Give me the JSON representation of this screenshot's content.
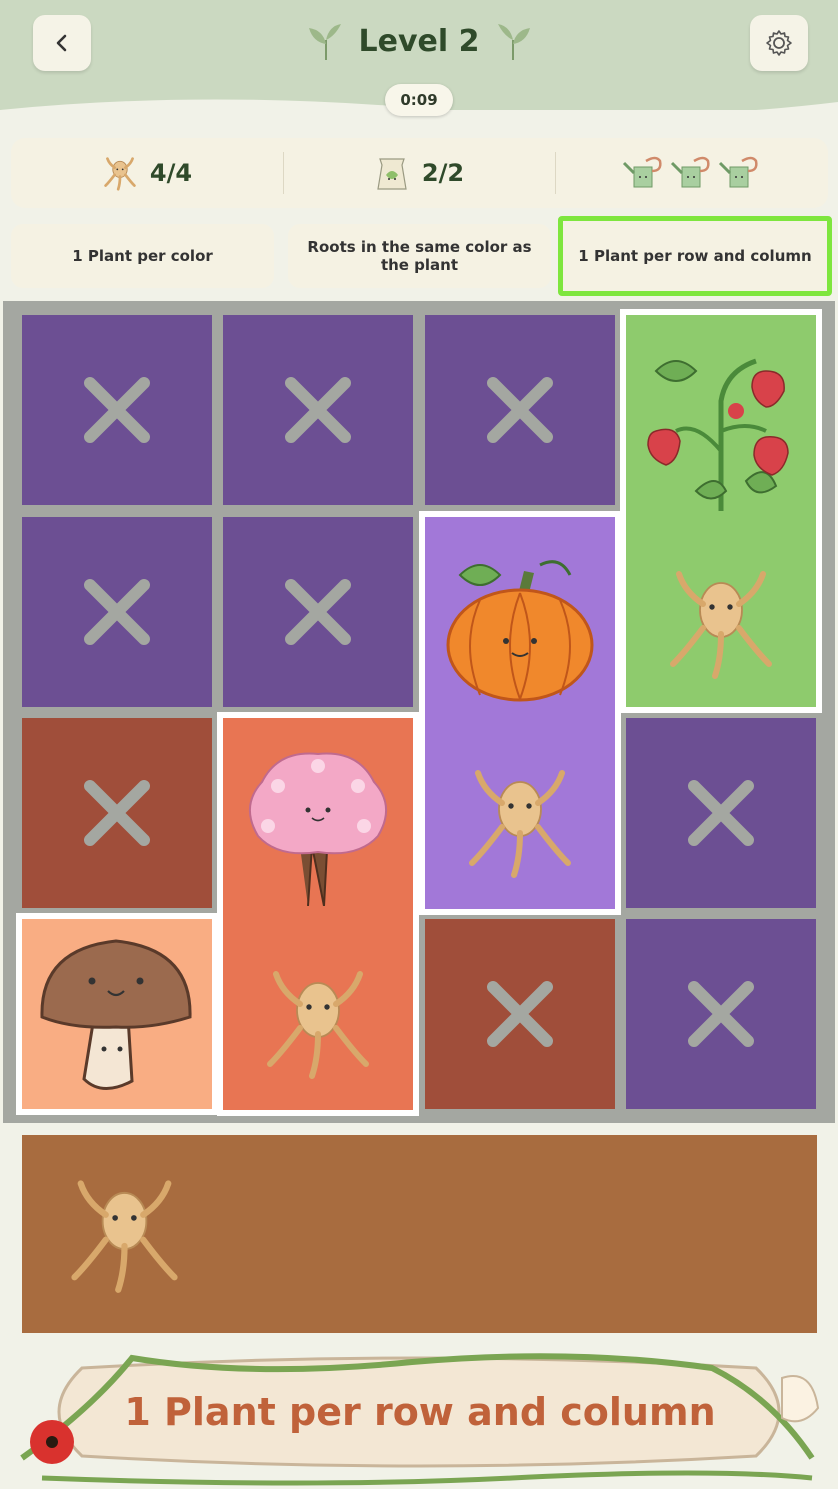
{
  "header": {
    "title": "Level 2",
    "timer": "0:09"
  },
  "stats": {
    "roots": "4/4",
    "seeds": "2/2",
    "watering_cans_count": 3
  },
  "rules": [
    {
      "label": "1 Plant per color",
      "active": false
    },
    {
      "label": "Roots in the same color as the plant",
      "active": false
    },
    {
      "label": "1 Plant per row and column",
      "active": true
    }
  ],
  "board": {
    "colors": {
      "purple": "#6c4f93",
      "light_purple": "#a278d8",
      "green": "#8ecb6d",
      "brown": "#a04e3a",
      "orange": "#e87553",
      "peach": "#f9ad83"
    },
    "cells": [
      {
        "row": 0,
        "col": 0,
        "color": "purple",
        "content": "cross"
      },
      {
        "row": 0,
        "col": 1,
        "color": "purple",
        "content": "cross"
      },
      {
        "row": 0,
        "col": 2,
        "color": "purple",
        "content": "cross"
      },
      {
        "row": 0,
        "col": 3,
        "color": "green",
        "content": "strawberry-plant",
        "span": 2
      },
      {
        "row": 1,
        "col": 0,
        "color": "purple",
        "content": "cross"
      },
      {
        "row": 1,
        "col": 1,
        "color": "purple",
        "content": "cross"
      },
      {
        "row": 1,
        "col": 2,
        "color": "light_purple",
        "content": "pumpkin",
        "span": 2
      },
      {
        "row": 2,
        "col": 0,
        "color": "brown",
        "content": "cross"
      },
      {
        "row": 2,
        "col": 1,
        "color": "orange",
        "content": "cherry-blossom-tree",
        "span": 2
      },
      {
        "row": 2,
        "col": 3,
        "color": "purple",
        "content": "cross"
      },
      {
        "row": 3,
        "col": 0,
        "color": "peach",
        "content": "mushroom"
      },
      {
        "row": 3,
        "col": 2,
        "color": "brown",
        "content": "cross"
      },
      {
        "row": 3,
        "col": 3,
        "color": "purple",
        "content": "cross"
      }
    ]
  },
  "tray": {
    "items": [
      "root"
    ]
  },
  "banner": {
    "text": "1 Plant per row and column"
  }
}
